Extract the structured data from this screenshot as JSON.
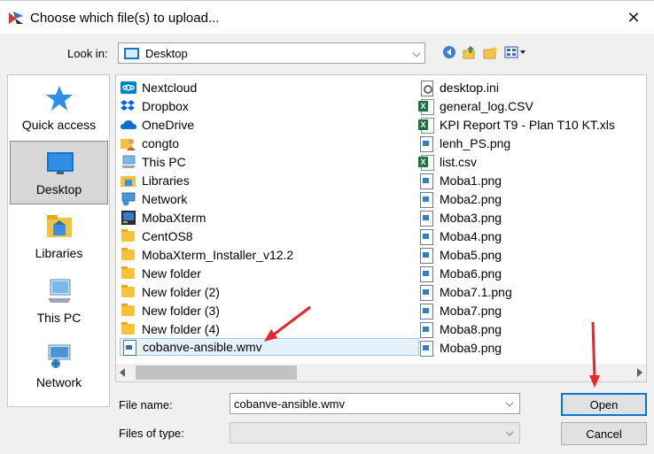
{
  "dialog": {
    "title": "Choose which file(s) to upload...",
    "close_glyph": "✕"
  },
  "toolbar": {
    "look_in_label": "Look in:",
    "look_in_value": "Desktop"
  },
  "places": [
    {
      "label": "Quick access",
      "icon": "quick-access-star-icon",
      "selected": false
    },
    {
      "label": "Desktop",
      "icon": "desktop-icon",
      "selected": true
    },
    {
      "label": "Libraries",
      "icon": "libraries-icon",
      "selected": false
    },
    {
      "label": "This PC",
      "icon": "this-pc-icon",
      "selected": false
    },
    {
      "label": "Network",
      "icon": "network-icon",
      "selected": false
    }
  ],
  "files_left": [
    {
      "name": "Nextcloud",
      "icon": "nextcloud-icon"
    },
    {
      "name": "Dropbox",
      "icon": "dropbox-icon"
    },
    {
      "name": "OneDrive",
      "icon": "onedrive-icon"
    },
    {
      "name": "congto",
      "icon": "user-folder-icon"
    },
    {
      "name": "This PC",
      "icon": "this-pc-icon"
    },
    {
      "name": "Libraries",
      "icon": "libraries-icon"
    },
    {
      "name": "Network",
      "icon": "network-icon"
    },
    {
      "name": "MobaXterm",
      "icon": "mobaxterm-icon"
    },
    {
      "name": "CentOS8",
      "icon": "folder-icon"
    },
    {
      "name": "MobaXterm_Installer_v12.2",
      "icon": "folder-icon"
    },
    {
      "name": "New folder",
      "icon": "folder-icon"
    },
    {
      "name": "New folder (2)",
      "icon": "folder-icon"
    },
    {
      "name": "New folder (3)",
      "icon": "folder-icon"
    },
    {
      "name": "New folder (4)",
      "icon": "folder-icon"
    },
    {
      "name": "cobanve-ansible.wmv",
      "icon": "video-file-icon",
      "selected": true
    }
  ],
  "files_right": [
    {
      "name": "desktop.ini",
      "icon": "ini-file-icon"
    },
    {
      "name": "general_log.CSV",
      "icon": "excel-file-icon"
    },
    {
      "name": "KPI Report T9 - Plan T10 KT.xls",
      "icon": "excel-file-icon"
    },
    {
      "name": "lenh_PS.png",
      "icon": "image-file-icon"
    },
    {
      "name": "list.csv",
      "icon": "excel-file-icon"
    },
    {
      "name": "Moba1.png",
      "icon": "image-file-icon"
    },
    {
      "name": "Moba2.png",
      "icon": "image-file-icon"
    },
    {
      "name": "Moba3.png",
      "icon": "image-file-icon"
    },
    {
      "name": "Moba4.png",
      "icon": "image-file-icon"
    },
    {
      "name": "Moba5.png",
      "icon": "image-file-icon"
    },
    {
      "name": "Moba6.png",
      "icon": "image-file-icon"
    },
    {
      "name": "Moba7.1.png",
      "icon": "image-file-icon"
    },
    {
      "name": "Moba7.png",
      "icon": "image-file-icon"
    },
    {
      "name": "Moba8.png",
      "icon": "image-file-icon"
    },
    {
      "name": "Moba9.png",
      "icon": "image-file-icon"
    }
  ],
  "form": {
    "file_name_label": "File name:",
    "file_name_value": "cobanve-ansible.wmv",
    "files_of_type_label": "Files of type:",
    "files_of_type_value": ""
  },
  "buttons": {
    "open": "Open",
    "cancel": "Cancel"
  },
  "colors": {
    "annotation_arrow": "#e8262a",
    "selection_bg": "#e5f1fb",
    "default_button_border": "#0078d7"
  }
}
